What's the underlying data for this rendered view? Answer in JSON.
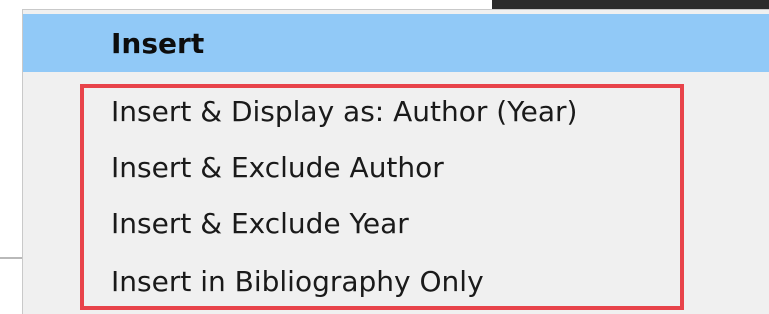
{
  "menu": {
    "items": [
      {
        "label": "Insert",
        "highlighted": true
      },
      {
        "label": "Insert & Display as: Author (Year)",
        "highlighted": false
      },
      {
        "label": "Insert & Exclude Author",
        "highlighted": false
      },
      {
        "label": "Insert & Exclude Year",
        "highlighted": false
      },
      {
        "label": "Insert in Bibliography Only",
        "highlighted": false
      }
    ]
  },
  "colors": {
    "highlight": "#91c9f7",
    "menu_background": "#f0f0f0",
    "callout": "#e8434a"
  }
}
